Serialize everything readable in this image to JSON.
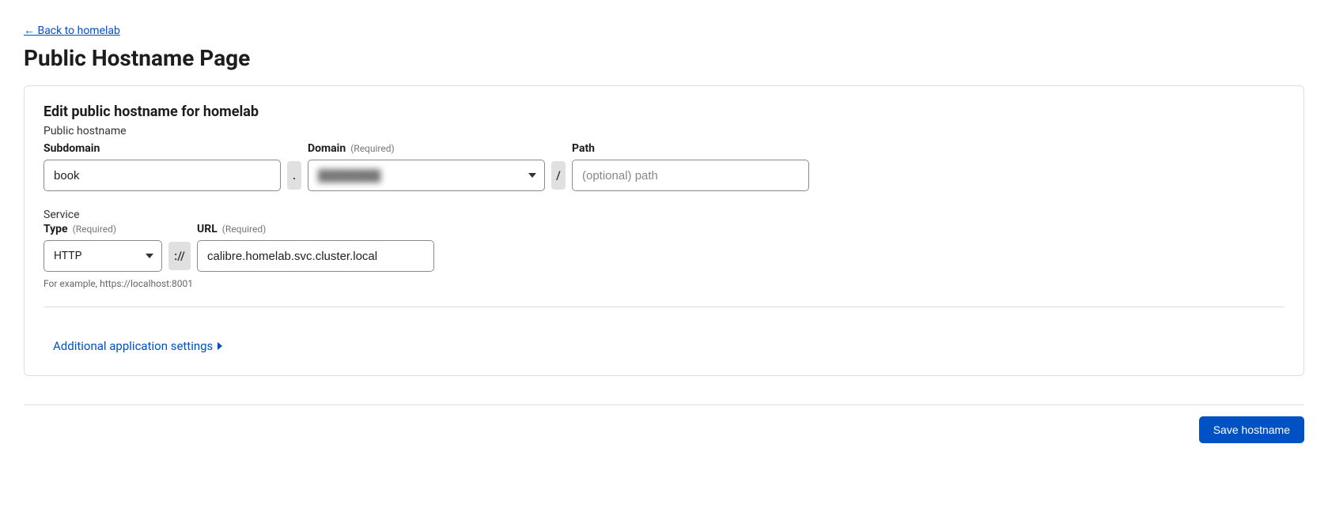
{
  "back_link": "← Back to homelab",
  "page_title": "Public Hostname Page",
  "card": {
    "heading": "Edit public hostname for homelab",
    "subtitle": "Public hostname",
    "subdomain": {
      "label": "Subdomain",
      "value": "book"
    },
    "domain": {
      "label": "Domain",
      "required": "(Required)",
      "value": "████████"
    },
    "path": {
      "label": "Path",
      "placeholder": "(optional) path",
      "value": ""
    },
    "separators": {
      "dot": ".",
      "slash": "/",
      "scheme": "://"
    },
    "service_label": "Service",
    "type": {
      "label": "Type",
      "required": "(Required)",
      "value": "HTTP"
    },
    "url": {
      "label": "URL",
      "required": "(Required)",
      "value": "calibre.homelab.svc.cluster.local"
    },
    "hint": "For example, https://localhost:8001",
    "additional": "Additional application settings"
  },
  "save_button": "Save hostname"
}
